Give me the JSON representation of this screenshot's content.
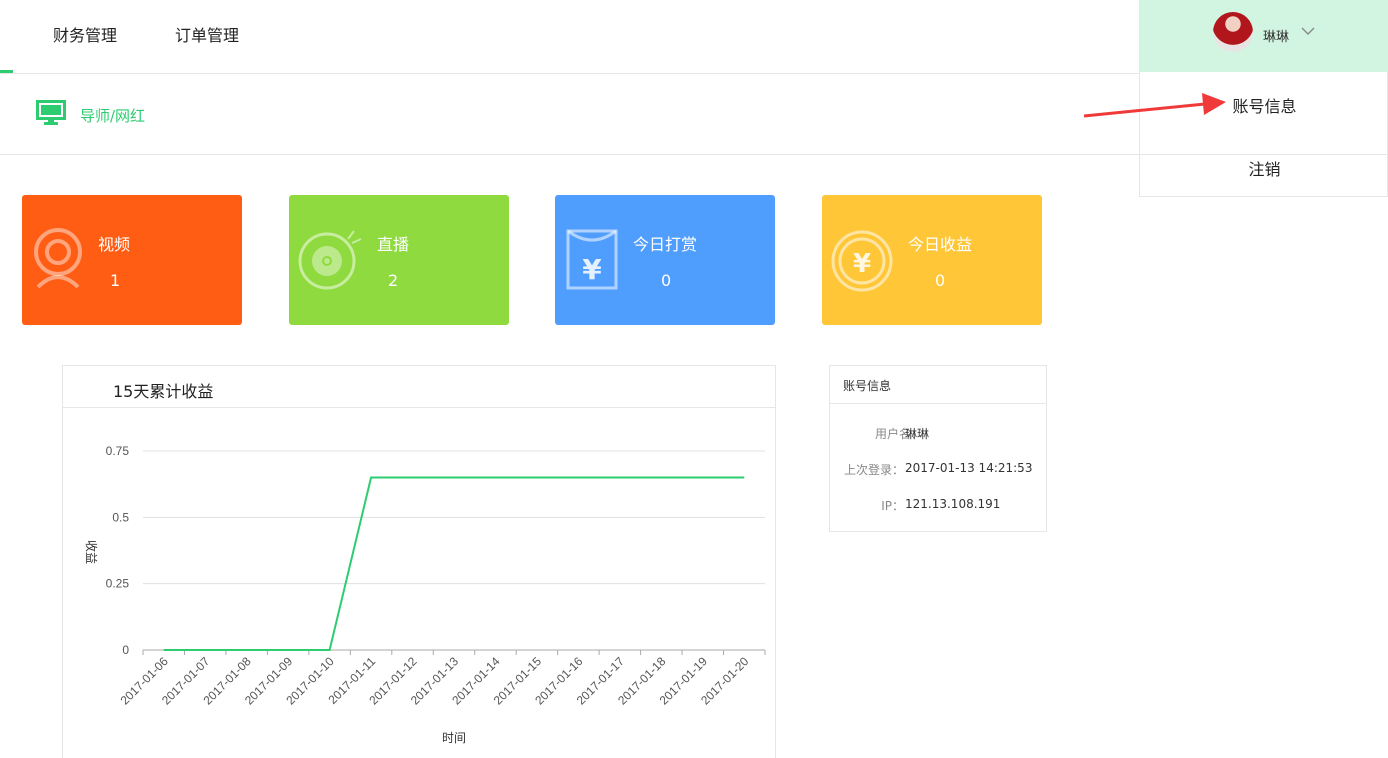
{
  "nav": {
    "items": [
      "财务管理",
      "订单管理"
    ]
  },
  "user": {
    "name": "琳琳",
    "dropdown": [
      "账号信息",
      "注销"
    ]
  },
  "breadcrumb": "导师/网红",
  "cards": [
    {
      "title": "视频",
      "value": "1",
      "color": "#ff5c14",
      "icon": "webcam-icon"
    },
    {
      "title": "直播",
      "value": "2",
      "color": "#8fda3e",
      "icon": "disc-icon"
    },
    {
      "title": "今日打赏",
      "value": "0",
      "color": "#4f9efd",
      "icon": "red-envelope-yen-icon"
    },
    {
      "title": "今日收益",
      "value": "0",
      "color": "#ffc637",
      "icon": "yen-coin-icon"
    }
  ],
  "chart": {
    "title": "15天累计收益",
    "xlabel": "时间",
    "ylabel": "收益",
    "yticks": [
      "0",
      "0.25",
      "0.5",
      "0.75"
    ]
  },
  "chart_data": {
    "type": "line",
    "x": [
      "2017-01-06",
      "2017-01-07",
      "2017-01-08",
      "2017-01-09",
      "2017-01-10",
      "2017-01-11",
      "2017-01-12",
      "2017-01-13",
      "2017-01-14",
      "2017-01-15",
      "2017-01-16",
      "2017-01-17",
      "2017-01-18",
      "2017-01-19",
      "2017-01-20"
    ],
    "series": [
      {
        "values": [
          0,
          0,
          0,
          0,
          0,
          0.65,
          0.65,
          0.65,
          0.65,
          0.65,
          0.65,
          0.65,
          0.65,
          0.65,
          0.65
        ],
        "color": "#2ecc71"
      }
    ],
    "title": "15天累计收益",
    "xlabel": "时间",
    "ylabel": "收益",
    "ylim": [
      0,
      0.75
    ],
    "grid": true
  },
  "account": {
    "title": "账号信息",
    "rows": [
      {
        "label": "用户名：",
        "value": "琳琳"
      },
      {
        "label": "上次登录：",
        "value": "2017-01-13 14:21:53"
      },
      {
        "label": "IP：",
        "value": "121.13.108.191"
      }
    ]
  }
}
